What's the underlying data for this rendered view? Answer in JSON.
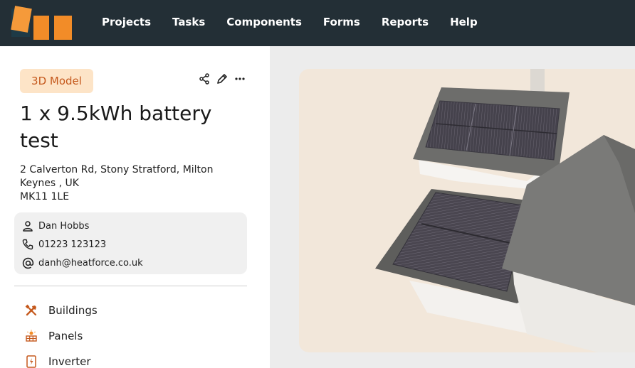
{
  "nav": {
    "items": [
      "Projects",
      "Tasks",
      "Components",
      "Forms",
      "Reports",
      "Help"
    ]
  },
  "project": {
    "badge": "3D Model",
    "title": "1 x 9.5kWh battery test",
    "address_lines": [
      "2 Calverton Rd, Stony Stratford, Milton",
      "Keynes , UK",
      "MK11 1LE"
    ]
  },
  "contact": {
    "name": "Dan Hobbs",
    "phone": "01223 123123",
    "email": "danh@heatforce.co.uk"
  },
  "menu": {
    "items": [
      {
        "label": "Buildings",
        "icon": "tools-icon"
      },
      {
        "label": "Panels",
        "icon": "solar-panel-icon"
      },
      {
        "label": "Inverter",
        "icon": "inverter-icon"
      }
    ]
  },
  "colors": {
    "topbar": "#232f36",
    "accent": "#f28c28",
    "badge_bg": "#fde4c7",
    "badge_text": "#c5591d",
    "viewer_bg": "#f2e7da"
  }
}
